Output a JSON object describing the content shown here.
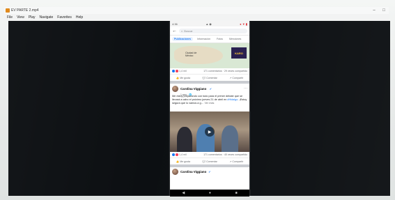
{
  "window": {
    "title": "EV PARTE 2.mp4",
    "minimize": "–",
    "maximize": "□"
  },
  "menu": [
    "File",
    "View",
    "Play",
    "Navigate",
    "Favorites",
    "Help"
  ],
  "phone": {
    "status_time": "4:36",
    "status_icons": "▲ ◉",
    "status_right": "● ▼ ▮",
    "search_placeholder": "Buscar",
    "tabs": [
      "Publicaciones",
      "Información",
      "Fotos",
      "Menciones"
    ],
    "map_post": {
      "map_label_1": "Ciudad de",
      "map_label_2": "México",
      "logo_text": "KARO",
      "reactions_count": "1,4 mil",
      "comments_text": "171 comentarios · 29 veces compartido",
      "actions": [
        "Me gusta",
        "Comentar",
        "Compartir"
      ]
    },
    "post": {
      "author": "Carolina Viggiano",
      "verified_mark": "✔",
      "time": "1 sem · ",
      "more": "···",
      "text": "Me estoy preparando con todo para el primer debate que se llevará a cabo el próximo jueves 21 de abril en ",
      "hashtag": "#Hidalgo",
      "text_tail": ". ¡Estoy segura que lo vamos a g…",
      "see_more": "Ver más",
      "reactions_count": "1,4 mil",
      "comments_text": "171 comentarios · 40 veces compartido",
      "actions": [
        "Me gusta",
        "Comentar",
        "Compartir"
      ]
    },
    "next_post_author": "Carolina Viggiano",
    "nav": [
      "◀",
      "●",
      "■"
    ]
  },
  "colors": {
    "video_bg": "#0c0f12",
    "facebook_blue": "#1877f2",
    "love_red": "#f33e58"
  }
}
